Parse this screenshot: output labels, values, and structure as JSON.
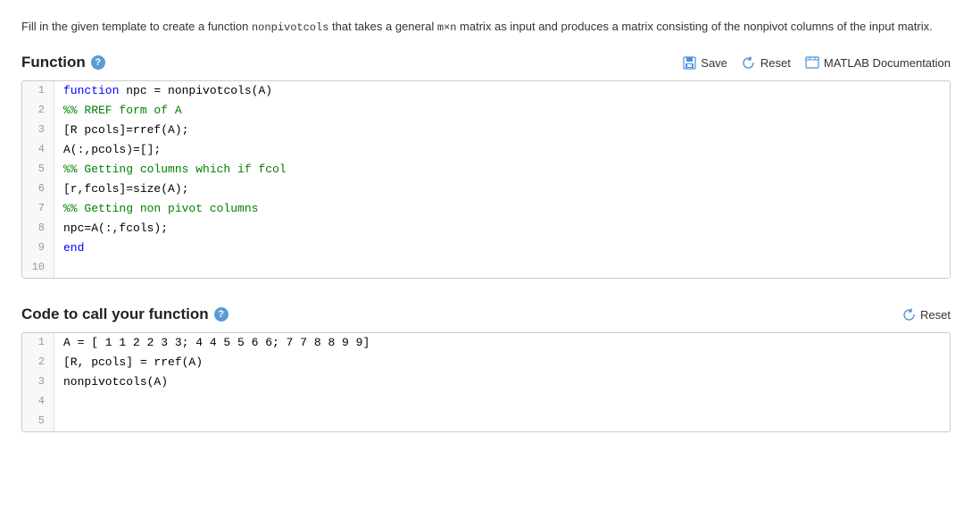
{
  "description": {
    "text_before": "Fill in the given template to create a function ",
    "func_name": "nonpivotcols",
    "text_middle": " that takes a general ",
    "matrix_dims": "m×n",
    "text_after": " matrix as input and produces a matrix consisting of the nonpivot columns of the input matrix."
  },
  "function_section": {
    "title": "Function",
    "help_icon": "?",
    "toolbar": {
      "save_label": "Save",
      "reset_label": "Reset",
      "matlab_label": "MATLAB Documentation"
    },
    "code_lines": [
      {
        "num": "1",
        "tokens": [
          {
            "type": "kw-blue",
            "text": "function"
          },
          {
            "type": "kw-black",
            "text": " npc = nonpivotcols(A)"
          }
        ]
      },
      {
        "num": "2",
        "tokens": [
          {
            "type": "kw-green",
            "text": "%% RREF form of A"
          }
        ]
      },
      {
        "num": "3",
        "tokens": [
          {
            "type": "kw-black",
            "text": "[R pcols]=rref(A);"
          }
        ]
      },
      {
        "num": "4",
        "tokens": [
          {
            "type": "kw-black",
            "text": "A(:,pcols)=[];"
          }
        ]
      },
      {
        "num": "5",
        "tokens": [
          {
            "type": "kw-green",
            "text": "%% Getting columns which if fcol"
          }
        ]
      },
      {
        "num": "6",
        "tokens": [
          {
            "type": "kw-black",
            "text": "[r,fcols]=size(A);"
          }
        ]
      },
      {
        "num": "7",
        "tokens": [
          {
            "type": "kw-green",
            "text": "%% Getting non pivot columns"
          }
        ]
      },
      {
        "num": "8",
        "tokens": [
          {
            "type": "kw-black",
            "text": "npc=A(:,fcols);"
          }
        ]
      },
      {
        "num": "9",
        "tokens": [
          {
            "type": "kw-blue",
            "text": "end"
          }
        ]
      },
      {
        "num": "10",
        "tokens": []
      }
    ]
  },
  "call_section": {
    "title": "Code to call your function",
    "help_icon": "?",
    "reset_label": "Reset",
    "code_lines": [
      {
        "num": "1",
        "tokens": [
          {
            "type": "kw-black",
            "text": "A = [ 1 1 2 2 3 3; 4 4 5 5 6 6; 7 7 8 8 9 9]"
          }
        ]
      },
      {
        "num": "2",
        "tokens": [
          {
            "type": "kw-black",
            "text": "[R, pcols] = rref(A)"
          }
        ]
      },
      {
        "num": "3",
        "tokens": [
          {
            "type": "kw-black",
            "text": "nonpivotcols(A)"
          }
        ]
      },
      {
        "num": "4",
        "tokens": []
      },
      {
        "num": "5",
        "tokens": []
      }
    ]
  }
}
